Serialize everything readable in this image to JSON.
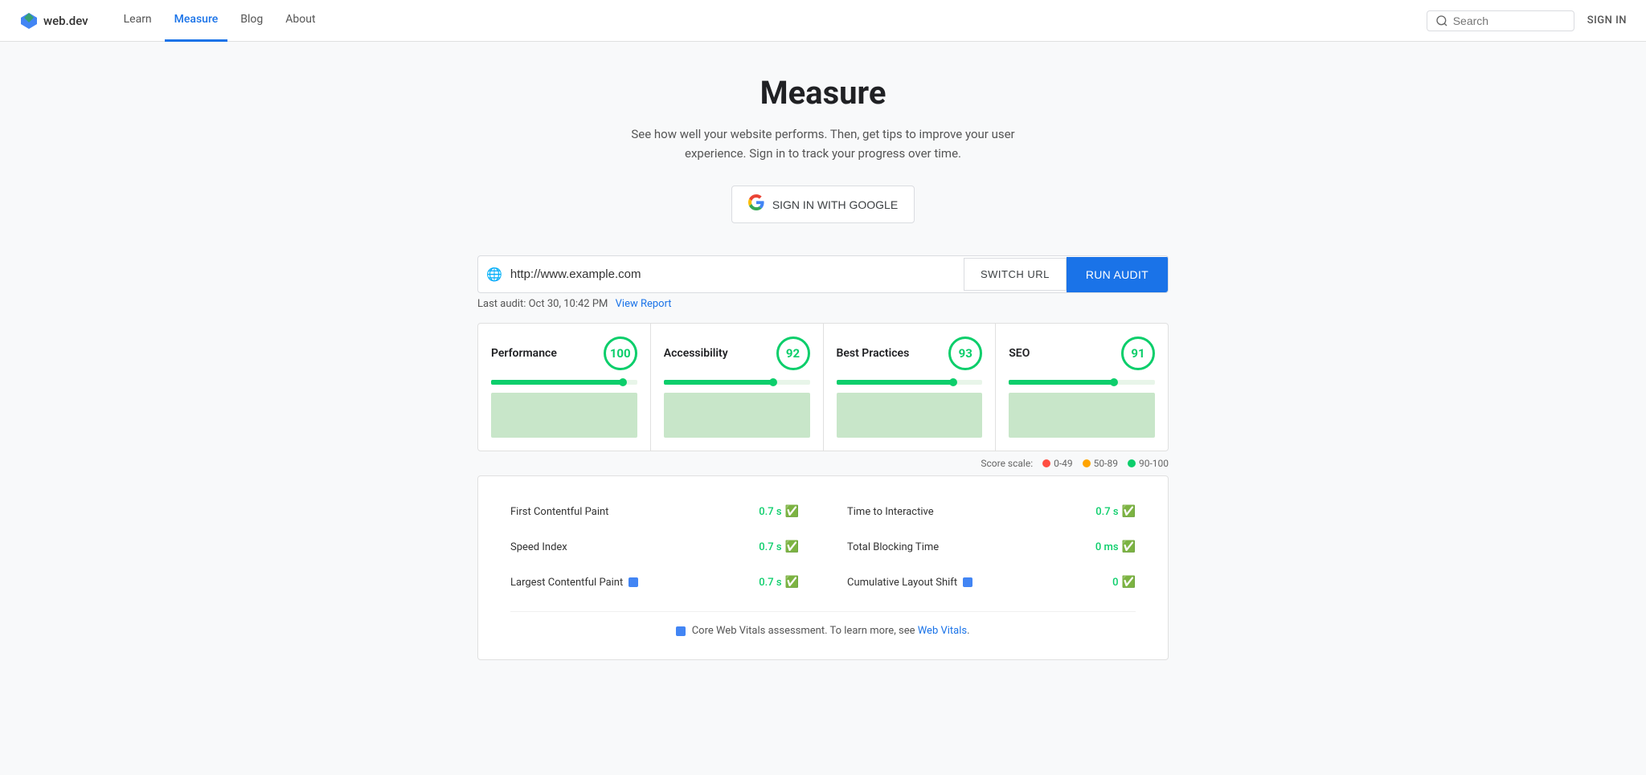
{
  "nav": {
    "logo_text": "web.dev",
    "links": [
      {
        "id": "learn",
        "label": "Learn",
        "active": false
      },
      {
        "id": "measure",
        "label": "Measure",
        "active": true
      },
      {
        "id": "blog",
        "label": "Blog",
        "active": false
      },
      {
        "id": "about",
        "label": "About",
        "active": false
      }
    ],
    "search_placeholder": "Search",
    "sign_in_label": "SIGN IN"
  },
  "header": {
    "title": "Measure",
    "subtitle_line1": "See how well your website performs. Then, get tips to improve your user",
    "subtitle_line2": "experience. Sign in to track your progress over time.",
    "google_signin_label": "SIGN IN WITH GOOGLE"
  },
  "url_section": {
    "url_value": "http://www.example.com",
    "switch_url_label": "SWITCH URL",
    "run_audit_label": "RUN AUDIT",
    "last_audit_text": "Last audit: Oct 30, 10:42 PM",
    "view_report_label": "View Report"
  },
  "scores": [
    {
      "id": "performance",
      "label": "Performance",
      "value": 100,
      "bar_width": "90"
    },
    {
      "id": "accessibility",
      "label": "Accessibility",
      "value": 92,
      "bar_width": "75"
    },
    {
      "id": "best_practices",
      "label": "Best Practices",
      "value": 93,
      "bar_width": "80"
    },
    {
      "id": "seo",
      "label": "SEO",
      "value": 91,
      "bar_width": "72"
    }
  ],
  "score_scale": {
    "label": "Score scale:",
    "items": [
      {
        "id": "low",
        "range": "0-49",
        "color": "#ff4e42"
      },
      {
        "id": "mid",
        "range": "50-89",
        "color": "#ffa400"
      },
      {
        "id": "high",
        "range": "90-100",
        "color": "#0cce6b"
      }
    ]
  },
  "metrics": [
    {
      "id": "fcp",
      "label": "First Contentful Paint",
      "value": "0.7 s",
      "badge": false
    },
    {
      "id": "tti",
      "label": "Time to Interactive",
      "value": "0.7 s",
      "badge": false
    },
    {
      "id": "si",
      "label": "Speed Index",
      "value": "0.7 s",
      "badge": false
    },
    {
      "id": "tbt",
      "label": "Total Blocking Time",
      "value": "0 ms",
      "badge": false
    },
    {
      "id": "lcp",
      "label": "Largest Contentful Paint",
      "value": "0.7 s",
      "badge": true
    },
    {
      "id": "cls",
      "label": "Cumulative Layout Shift",
      "value": "0",
      "badge": true
    }
  ],
  "core_web_vitals": {
    "text": "Core Web Vitals assessment. To learn more, see",
    "link_label": "Web Vitals",
    "link_href": "#"
  }
}
